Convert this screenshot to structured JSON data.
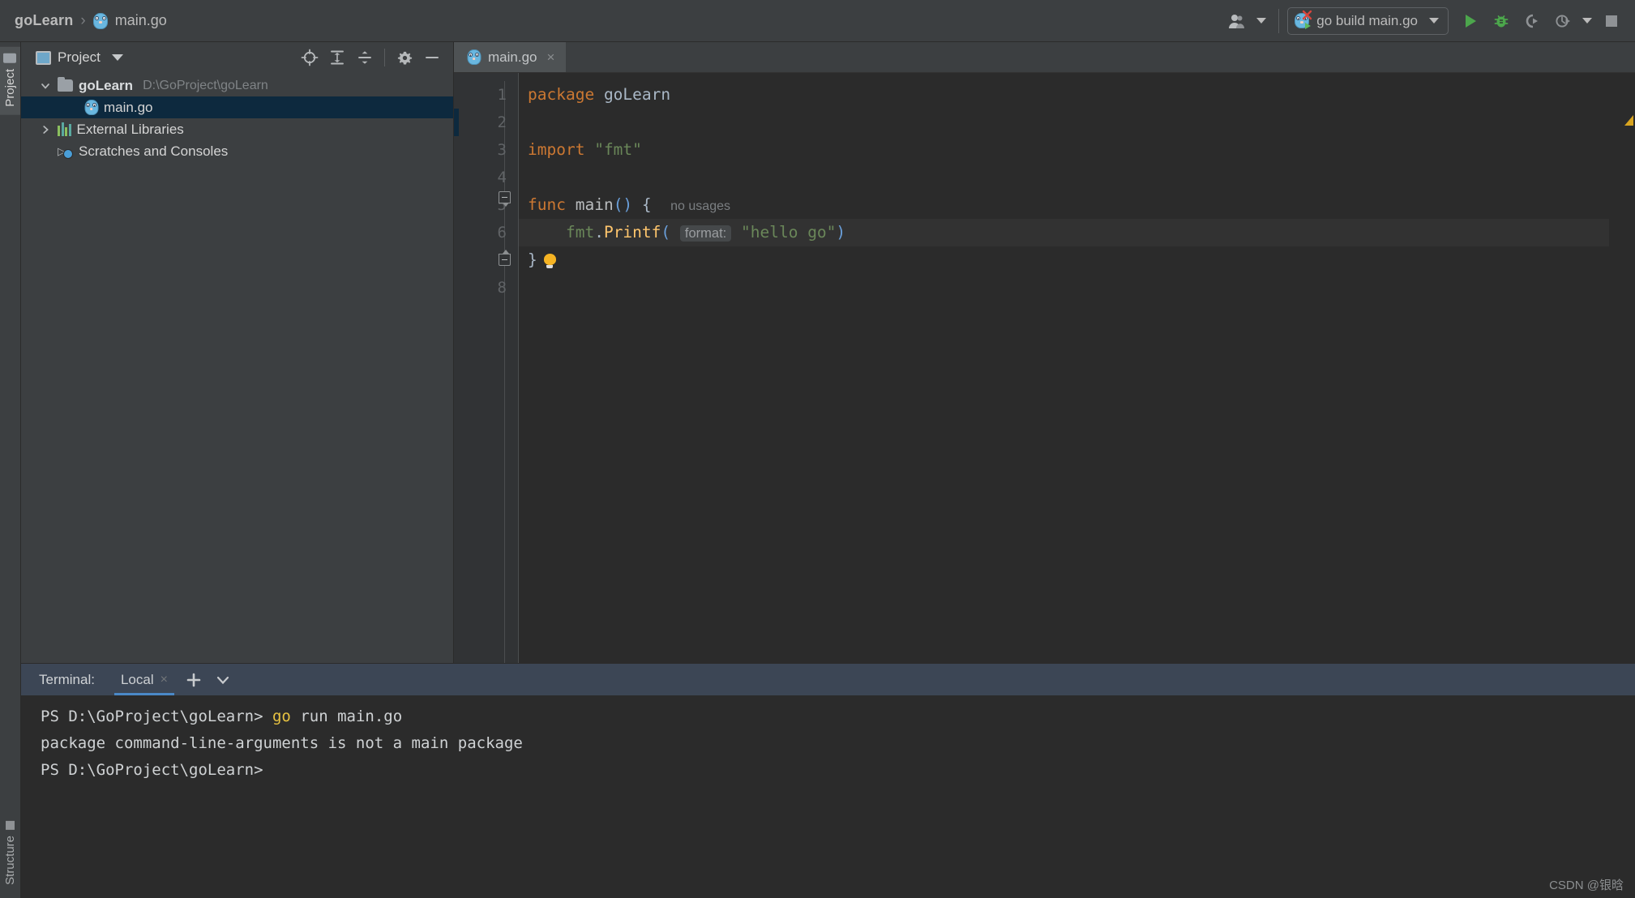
{
  "app": {
    "breadcrumb": {
      "project": "goLearn",
      "separator": "›",
      "file": "main.go"
    }
  },
  "toolbar": {
    "profile_icon": "user-profile-icon",
    "run_config": {
      "label": "go build main.go",
      "icon": "go-build-config-icon"
    },
    "actions": [
      {
        "name": "run-button",
        "icon": "play-icon",
        "color": "#5eb85e"
      },
      {
        "name": "debug-button",
        "icon": "bug-icon",
        "color": "#5eb85e"
      },
      {
        "name": "run-with-coverage-button",
        "icon": "coverage-icon",
        "color": "#8b8e90"
      },
      {
        "name": "profiler-button",
        "icon": "profiler-icon",
        "color": "#8b8e90"
      },
      {
        "name": "stop-button",
        "icon": "stop-square-icon",
        "color": "#8b8e90"
      }
    ]
  },
  "left_stripe": {
    "top_label": "Project",
    "bottom_label": "Structure"
  },
  "project_panel": {
    "title": "Project",
    "tools": [
      {
        "name": "locate-file-icon",
        "label": "Select Opened File"
      },
      {
        "name": "expand-all-icon",
        "label": "Expand All"
      },
      {
        "name": "collapse-all-icon",
        "label": "Collapse All"
      },
      {
        "name": "gear-icon",
        "label": "Settings"
      },
      {
        "name": "minimize-icon",
        "label": "Hide"
      }
    ],
    "tree": [
      {
        "label": "goLearn",
        "path": "D:\\GoProject\\goLearn",
        "icon": "folder-icon",
        "arrow": "⌄",
        "expanded": true,
        "bold": true,
        "selected": false,
        "indent": 1
      },
      {
        "label": "main.go",
        "path": "",
        "icon": "go-file-icon",
        "arrow": "",
        "expanded": false,
        "bold": false,
        "selected": true,
        "indent": 2
      },
      {
        "label": "External Libraries",
        "path": "",
        "icon": "libraries-icon",
        "arrow": "›",
        "expanded": false,
        "bold": false,
        "selected": false,
        "indent": 1
      },
      {
        "label": "Scratches and Consoles",
        "path": "",
        "icon": "scratches-icon",
        "arrow": "",
        "expanded": false,
        "bold": false,
        "selected": false,
        "indent": 1
      }
    ]
  },
  "editor": {
    "tabs": [
      {
        "label": "main.go",
        "icon": "go-file-icon",
        "active": true,
        "close": "×"
      }
    ],
    "line_numbers": [
      "1",
      "2",
      "3",
      "4",
      "5",
      "6",
      "7",
      "8"
    ],
    "code": {
      "line1_kw": "package",
      "line1_name": "goLearn",
      "line3_kw": "import",
      "line3_str": "\"fmt\"",
      "line5_kw": "func",
      "line5_name": "main",
      "line5_parens": "()",
      "line5_brace": "{",
      "line5_hint": "no usages",
      "line6_pkg": "fmt",
      "line6_dot": ".",
      "line6_fn": "Printf",
      "line6_open": "(",
      "line6_param_hint": "format:",
      "line6_str": "\"hello go\"",
      "line6_close": ")",
      "line7_brace": "}"
    },
    "inspection_marker": "warning-triangle"
  },
  "terminal": {
    "title": "Terminal:",
    "tabs": [
      {
        "label": "Local",
        "active": true,
        "close": "×"
      }
    ],
    "buttons": [
      {
        "name": "new-terminal-tab-button",
        "glyph": "+"
      },
      {
        "name": "terminal-options-chevron",
        "glyph": "⌄"
      }
    ],
    "lines": [
      {
        "prompt": "PS D:\\GoProject\\goLearn> ",
        "highlight": "go",
        "rest": " run main.go"
      },
      {
        "prompt": "",
        "highlight": "",
        "rest": "package command-line-arguments is not a main package"
      },
      {
        "prompt": "PS D:\\GoProject\\goLearn>",
        "highlight": "",
        "rest": ""
      }
    ]
  },
  "watermark": "CSDN @银晗",
  "colors": {
    "background": "#3c3f41",
    "editor_background": "#2b2b2b",
    "selection": "#0d293e",
    "accent": "#4a88c7",
    "keyword": "#cc7832",
    "string": "#6a8759",
    "function": "#ffc66d",
    "terminal_header": "#3c4655",
    "run_green": "#5eb85e",
    "warning": "#d9a520"
  }
}
